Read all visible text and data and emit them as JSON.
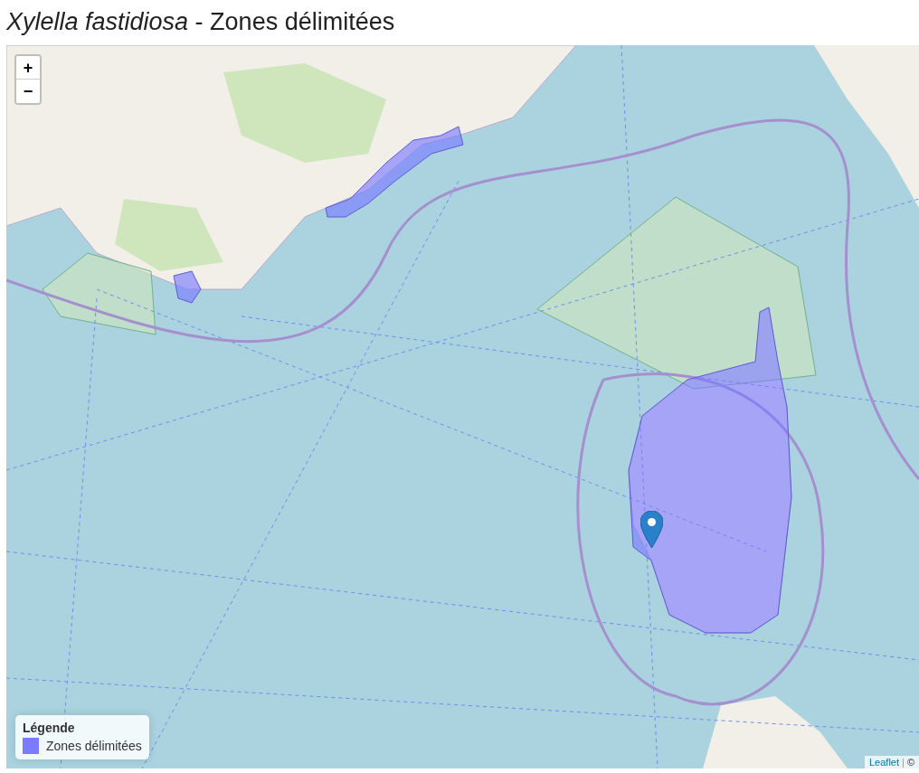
{
  "page_title": "*Xylella fastidiosa* - Zones délimitées",
  "map": {
    "zoom_in": "+",
    "zoom_out": "−",
    "legend": {
      "title": "Légende",
      "items": [
        {
          "label": "Zones délimitées",
          "color": "#7b7bff"
        }
      ]
    },
    "attribution": {
      "link": "Leaflet",
      "separator": "|",
      "symbol": "©"
    }
  }
}
